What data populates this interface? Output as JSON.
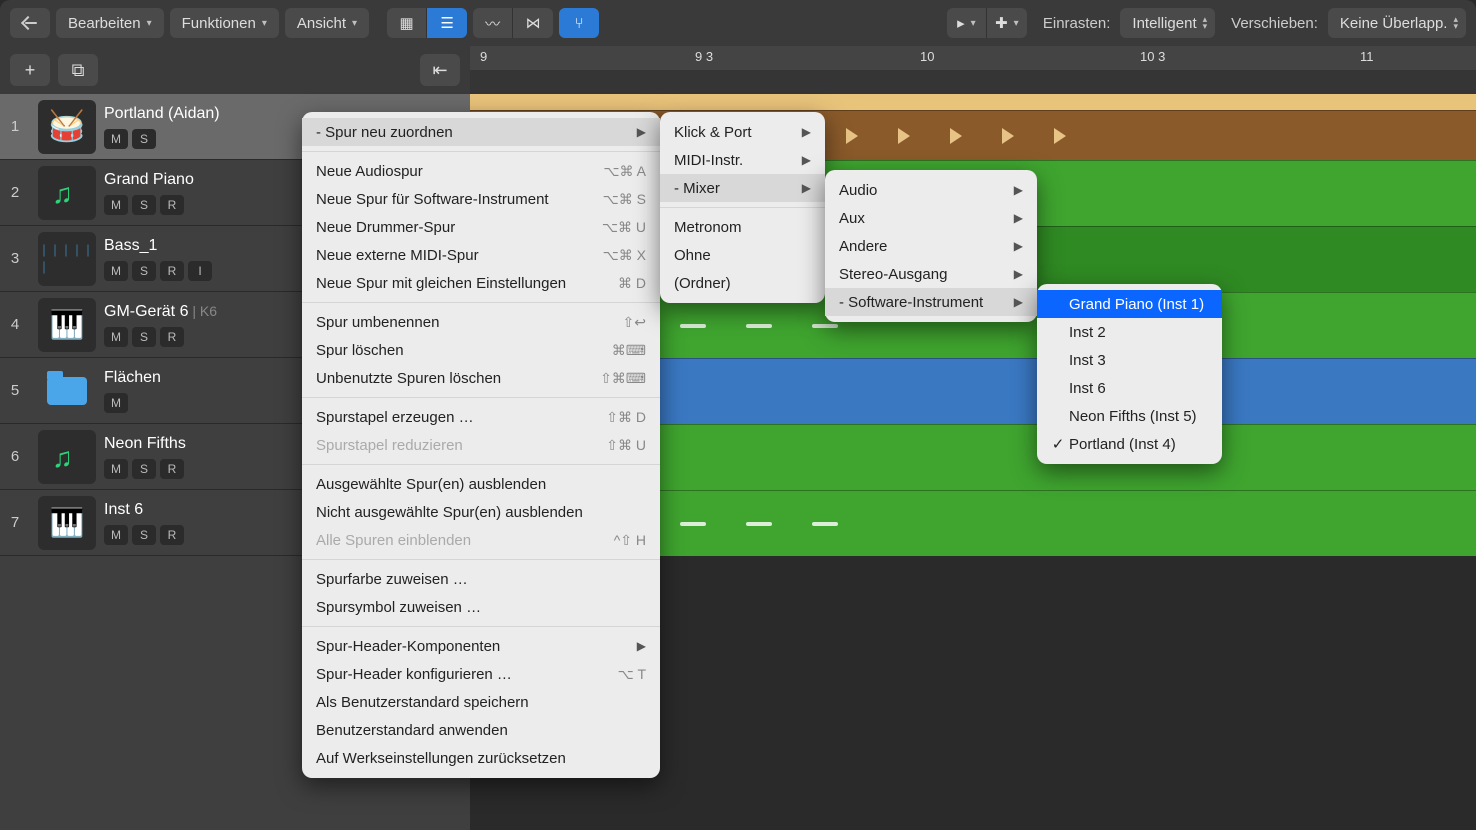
{
  "toolbar": {
    "edit": "Bearbeiten",
    "functions": "Funktionen",
    "view": "Ansicht",
    "snap_label": "Einrasten:",
    "snap_value": "Intelligent",
    "move_label": "Verschieben:",
    "move_value": "Keine Überlapp."
  },
  "ruler": {
    "t1": "9",
    "t2": "9 3",
    "t3": "10",
    "t4": "10 3",
    "t5": "11"
  },
  "tracks": [
    {
      "num": "1",
      "name": "Portland (Aidan)",
      "btns": [
        "M",
        "S"
      ],
      "icon": "drums"
    },
    {
      "num": "2",
      "name": "Grand Piano",
      "btns": [
        "M",
        "S",
        "R"
      ],
      "icon": "note"
    },
    {
      "num": "3",
      "name": "Bass_1",
      "btns": [
        "M",
        "S",
        "R",
        "I"
      ],
      "icon": "wave"
    },
    {
      "num": "4",
      "name": "GM-Gerät 6",
      "tag": "| K6",
      "btns": [
        "M",
        "S",
        "R"
      ],
      "icon": "piano"
    },
    {
      "num": "5",
      "name": "Flächen",
      "btns": [
        "M"
      ],
      "icon": "folder"
    },
    {
      "num": "6",
      "name": "Neon Fifths",
      "btns": [
        "M",
        "S",
        "R"
      ],
      "icon": "note"
    },
    {
      "num": "7",
      "name": "Inst 6",
      "btns": [
        "M",
        "S",
        "R"
      ],
      "icon": "keys"
    }
  ],
  "menu1": {
    "reassign": "- Spur neu zuordnen",
    "new_audio": "Neue Audiospur",
    "sc_audio": "⌥⌘ A",
    "new_swinst": "Neue Spur für Software-Instrument",
    "sc_sw": "⌥⌘ S",
    "new_drummer": "Neue Drummer-Spur",
    "sc_dr": "⌥⌘ U",
    "new_ext": "Neue externe MIDI-Spur",
    "sc_ext": "⌥⌘ X",
    "new_same": "Neue Spur mit gleichen Einstellungen",
    "sc_same": "⌘ D",
    "rename": "Spur umbenennen",
    "sc_ren": "⇧↩",
    "delete": "Spur löschen",
    "sc_del": "⌘⌨",
    "del_unused": "Unbenutzte Spuren löschen",
    "sc_du": "⇧⌘⌨",
    "stack_create": "Spurstapel erzeugen …",
    "sc_sc": "⇧⌘ D",
    "stack_reduce": "Spurstapel reduzieren",
    "sc_sr": "⇧⌘ U",
    "hide_sel": "Ausgewählte Spur(en) ausblenden",
    "hide_unsel": "Nicht ausgewählte Spur(en) ausblenden",
    "show_all": "Alle Spuren einblenden",
    "sc_sa": "^⇧ H",
    "color": "Spurfarbe zuweisen …",
    "symbol": "Spursymbol zuweisen …",
    "header_comp": "Spur-Header-Komponenten",
    "header_conf": "Spur-Header konfigurieren …",
    "sc_hc": "⌥ T",
    "save_def": "Als Benutzerstandard speichern",
    "apply_def": "Benutzerstandard anwenden",
    "reset": "Auf Werkseinstellungen zurücksetzen"
  },
  "menu2": {
    "click": "Klick & Port",
    "midi": "MIDI-Instr.",
    "mixer": "- Mixer",
    "metro": "Metronom",
    "none": "Ohne",
    "folder": "(Ordner)"
  },
  "menu3": {
    "audio": "Audio",
    "aux": "Aux",
    "other": "Andere",
    "stereo": "Stereo-Ausgang",
    "sw": "- Software-Instrument"
  },
  "menu4": {
    "i1": "Grand Piano (Inst 1)",
    "i2": "Inst 2",
    "i3": "Inst 3",
    "i6": "Inst 6",
    "i5": "Neon Fifths (Inst 5)",
    "i4": "Portland (Inst 4)"
  }
}
